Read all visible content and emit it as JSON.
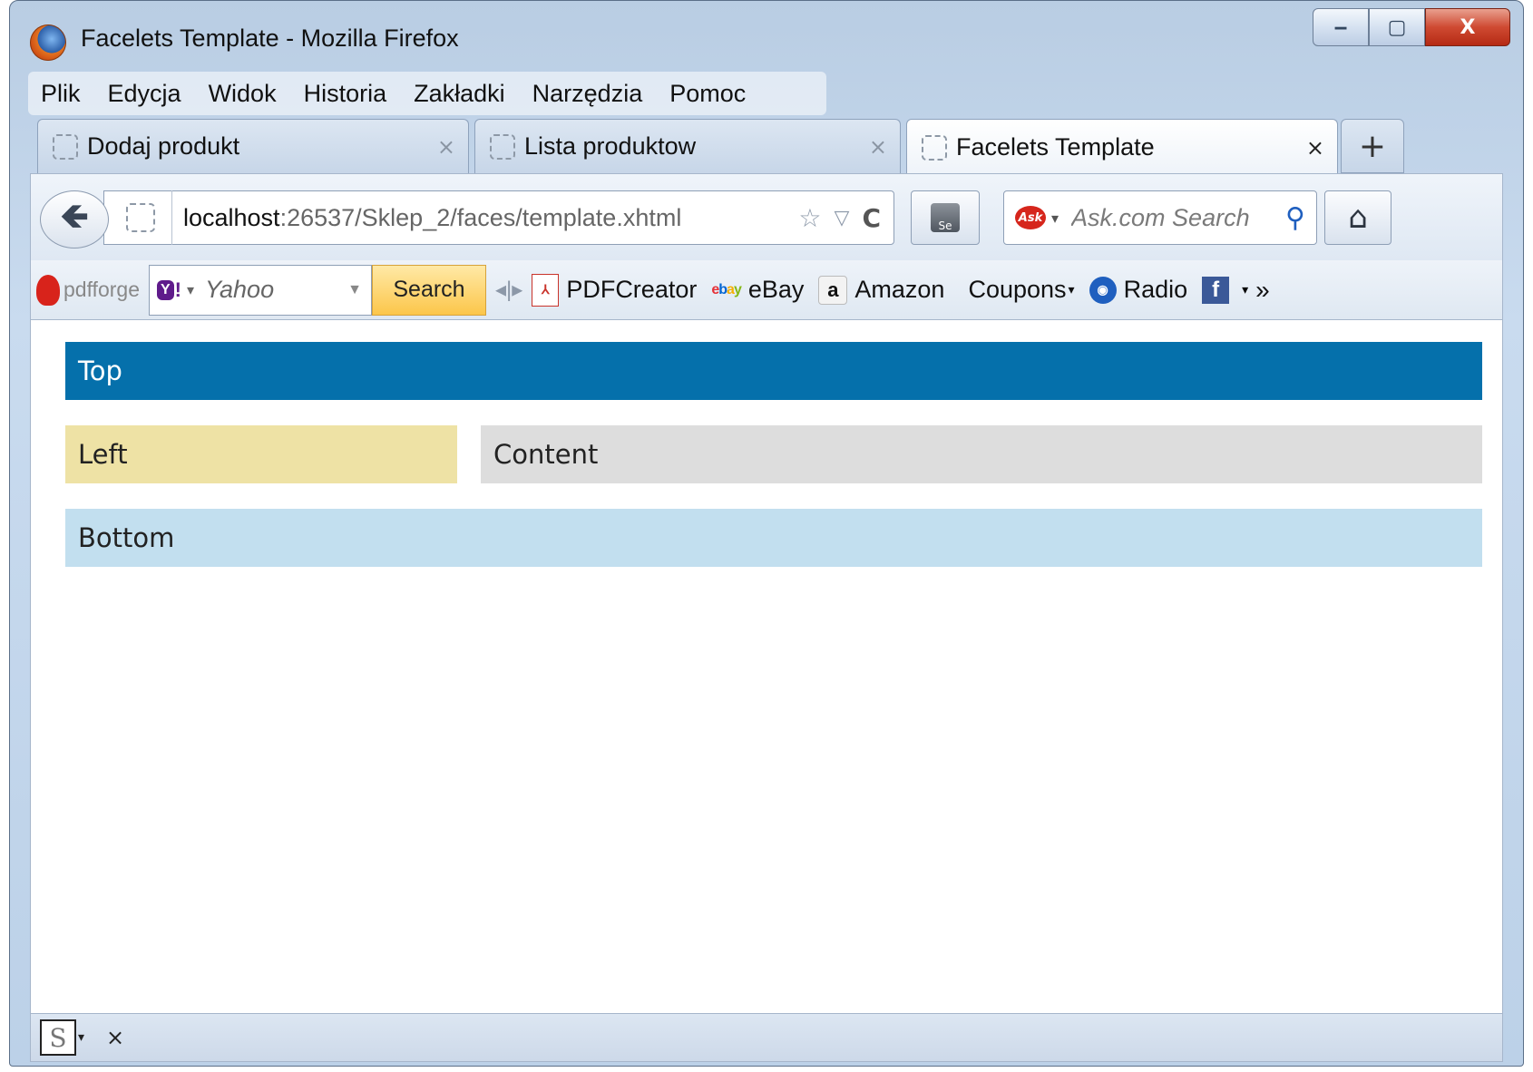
{
  "window": {
    "title": "Facelets Template - Mozilla Firefox",
    "controls": {
      "minimize": "‒",
      "maximize": "▢",
      "close": "X"
    }
  },
  "menu": [
    "Plik",
    "Edycja",
    "Widok",
    "Historia",
    "Zakładki",
    "Narzędzia",
    "Pomoc"
  ],
  "tabs": [
    {
      "label": "Dodaj produkt",
      "active": false
    },
    {
      "label": "Lista produktow",
      "active": false
    },
    {
      "label": "Facelets Template",
      "active": true
    }
  ],
  "tab_new": "+",
  "tab_close_glyph": "×",
  "navbar": {
    "back_glyph": "🡸",
    "url_host": "localhost",
    "url_rest": ":26537/Sklep_2/faces/template.xhtml",
    "bookmark_star": "☆",
    "dropdown": "▽",
    "reload": "C",
    "selenium_label": "Se",
    "ask_logo": "Ask",
    "search_placeholder": "Ask.com Search",
    "home_glyph": "⌂"
  },
  "bookmarks_bar": {
    "pdfforge": "pdfforge",
    "yahoo_logo": "Y",
    "yahoo_text": "Yahoo",
    "search_button": "Search",
    "items": [
      {
        "label": "PDFCreator",
        "icon": "pdf-icon"
      },
      {
        "label": "eBay",
        "icon": "ebay-icon"
      },
      {
        "label": "Amazon",
        "icon": "amazon-icon"
      },
      {
        "label": "Coupons",
        "icon": "coupons"
      },
      {
        "label": "Radio",
        "icon": "radio-icon"
      }
    ],
    "more": "»"
  },
  "page": {
    "top": "Top",
    "left": "Left",
    "content": "Content",
    "bottom": "Bottom"
  },
  "statusbar": {
    "s_icon": "S",
    "close": "×"
  },
  "colors": {
    "top": "#0570ab",
    "left": "#eee2a5",
    "content": "#dddddd",
    "bottom": "#c2dfef"
  }
}
